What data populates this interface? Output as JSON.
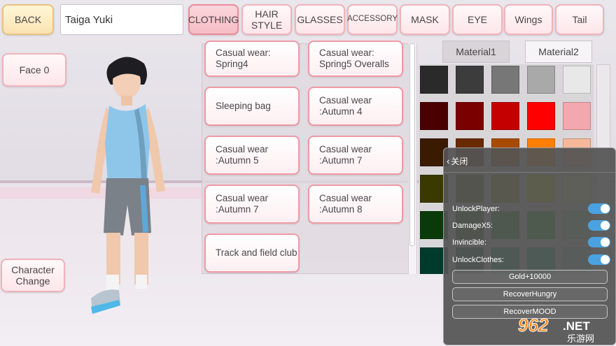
{
  "top_bar": {
    "back_label": "BACK",
    "character_name": "Taiga Yuki",
    "tabs": [
      {
        "label": "CLOTHING",
        "active": true
      },
      {
        "label": "HAIR STYLE",
        "active": false
      },
      {
        "label": "GLASSES",
        "active": false
      },
      {
        "label": "ACCESSORY",
        "active": false
      },
      {
        "label": "MASK",
        "active": false
      },
      {
        "label": "EYE",
        "active": false
      },
      {
        "label": "Wings",
        "active": false
      },
      {
        "label": "Tail",
        "active": false
      }
    ]
  },
  "left_panel": {
    "face_label": "Face",
    "face_value": "0",
    "character_change_label": "Character Change"
  },
  "clothing_list": {
    "items": [
      "Casual wear: Spring4",
      "Casual wear: Spring5 Overalls",
      "Sleeping bag",
      "Casual wear :Autumn 4",
      "Casual wear :Autumn 5",
      "Casual wear :Autumn 7",
      "Casual wear :Autumn 7",
      "Casual wear :Autumn 8",
      "Track and field club"
    ]
  },
  "material_tabs": [
    "Material1",
    "Material2"
  ],
  "color_swatches": [
    [
      "#2a2a2a",
      "#3c3c3c",
      "#777777",
      "#a9a9a9",
      "#e8e8e8"
    ],
    [
      "#4a0000",
      "#7a0000",
      "#c40000",
      "#ff0000",
      "#f2a8ae"
    ],
    [
      "#3a1a00",
      "#6a2a00",
      "#a84a00",
      "#ff8000",
      "#f5b89a"
    ],
    [
      "#3a3a00",
      "#555500",
      "#8a8a00",
      "#cccc00",
      "#e6e6a0"
    ],
    [
      "#0a3a0a",
      "#0f5a0f",
      "#138a13",
      "#1aaa1a",
      "#9ad69a"
    ],
    [
      "#003a2a",
      "#005a40",
      "#008a60",
      "#00aa77",
      "#88d6bb"
    ]
  ],
  "mod_menu": {
    "close_label": "关闭",
    "toggles": [
      {
        "label": "UnlockPlayer:",
        "on": true
      },
      {
        "label": "DamageX5:",
        "on": true
      },
      {
        "label": "Invincible:",
        "on": true
      },
      {
        "label": "UnlockClothes:",
        "on": true
      }
    ],
    "buttons": [
      "Gold+10000",
      "RecoverHungry",
      "RecoverMOOD"
    ]
  },
  "watermark": {
    "number": "962",
    "suffix": ".NET",
    "chinese": "乐游网"
  }
}
